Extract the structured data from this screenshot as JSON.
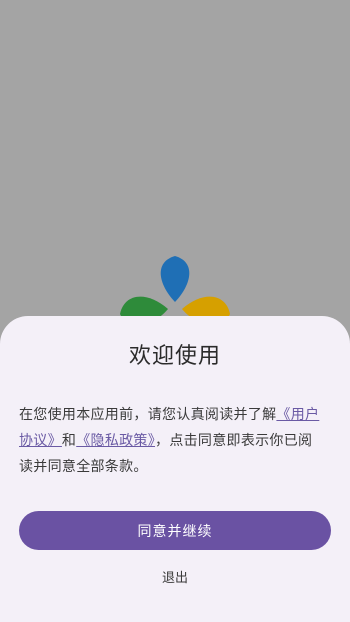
{
  "dialog": {
    "title": "欢迎使用",
    "text_prefix": "在您使用本应用前，请您认真阅读并了解",
    "user_agreement_link": "《用户协议》",
    "text_and": "和",
    "privacy_policy_link": "《隐私政策》",
    "text_suffix": "，点击同意即表示你已阅读并同意全部条款。",
    "agree_button": "同意并继续",
    "exit_button": "退出"
  },
  "colors": {
    "overlay": "#a4a4a4",
    "sheet_background": "#f4f0f8",
    "primary": "#6a52a3",
    "link": "#6a5aa4",
    "logo_blue": "#1f6fb5",
    "logo_green": "#2e8b3a",
    "logo_yellow": "#d6a000"
  },
  "icons": {
    "app_logo": "three-petal-logo-icon"
  }
}
